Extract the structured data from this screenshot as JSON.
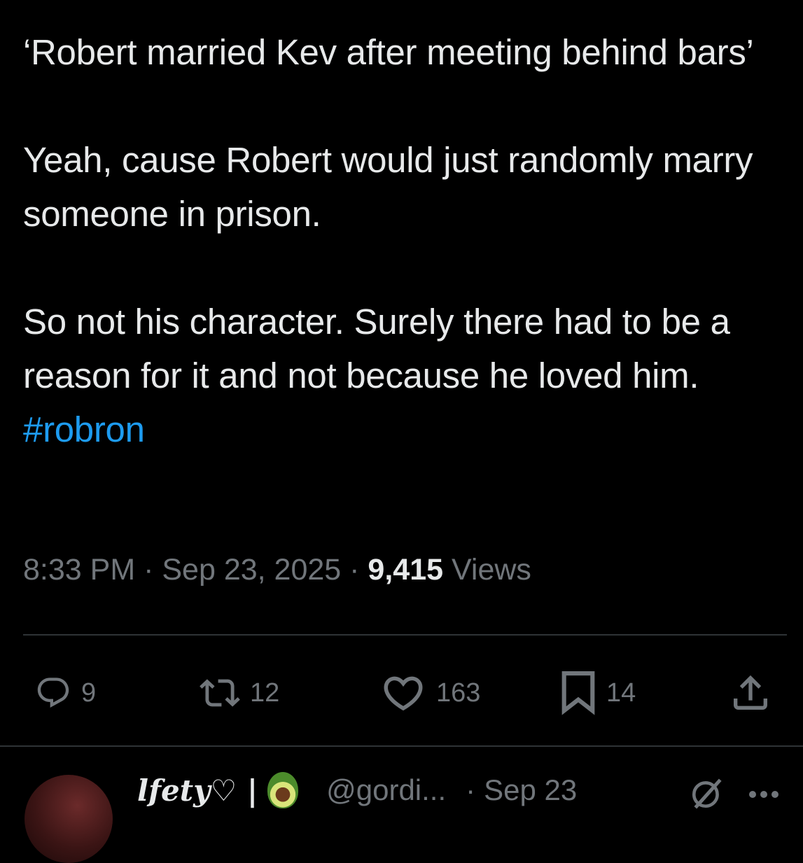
{
  "tweet": {
    "paragraphs": [
      "‘Robert married Kev after meeting behind bars’",
      "Yeah, cause Robert would just randomly marry someone in prison.",
      "So not his character. Surely there had to be a reason for it and not because he loved him. "
    ],
    "hashtag": "#robron"
  },
  "meta": {
    "time": "8:33 PM",
    "separator": " · ",
    "date": "Sep 23, 2025",
    "views_count": "9,415",
    "views_label": "Views"
  },
  "actions": {
    "replies": "9",
    "reposts": "12",
    "likes": "163",
    "bookmarks": "14"
  },
  "reply": {
    "name": "lfety♡ |",
    "handle": "@gordi...",
    "separator": "·",
    "date": "Sep 23"
  },
  "colors": {
    "background": "#000000",
    "text": "#e7e9ea",
    "secondary": "#71767b",
    "link": "#1d9bf0",
    "divider": "#2f3336"
  },
  "icons": [
    "reply-icon",
    "repost-icon",
    "like-icon",
    "bookmark-icon",
    "share-icon",
    "grok-icon",
    "more-icon"
  ]
}
